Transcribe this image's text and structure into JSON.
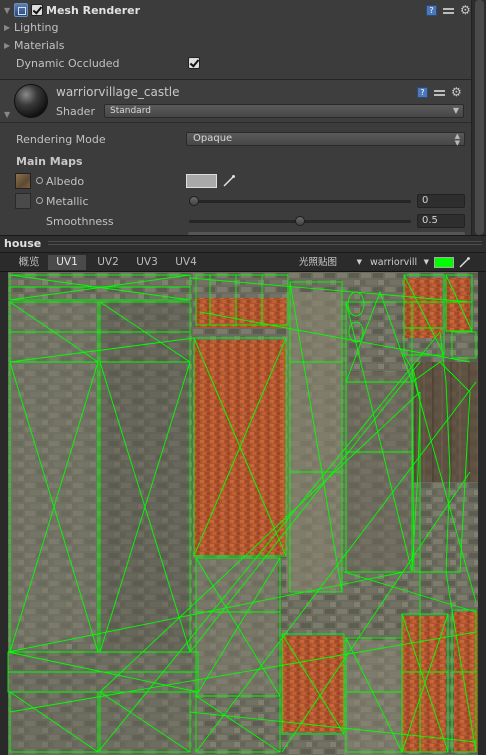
{
  "inspector": {
    "mesh_renderer": {
      "title": "Mesh Renderer",
      "enabled": true,
      "lighting_label": "Lighting",
      "materials_label": "Materials",
      "dynamic_occluded_label": "Dynamic Occluded",
      "dynamic_occluded": true
    },
    "material": {
      "name": "warriorvillage_castle",
      "shader_label": "Shader",
      "shader_value": "Standard",
      "rendering_mode_label": "Rendering Mode",
      "rendering_mode_value": "Opaque",
      "main_maps_label": "Main Maps",
      "albedo_label": "Albedo",
      "albedo_color": "#a9a9a9",
      "metallic_label": "Metallic",
      "metallic_value": "0",
      "metallic_fraction": 0.0,
      "smoothness_label": "Smoothness",
      "smoothness_value": "0.5",
      "smoothness_fraction": 0.5
    }
  },
  "uv_panel": {
    "title": "house",
    "tabs": [
      "概览",
      "UV1",
      "UV2",
      "UV3",
      "UV4"
    ],
    "active_tab": "UV1",
    "lightmap_dropdown": "光照贴图",
    "texture_dropdown": "warriorvill",
    "wire_color": "#00ff00"
  }
}
